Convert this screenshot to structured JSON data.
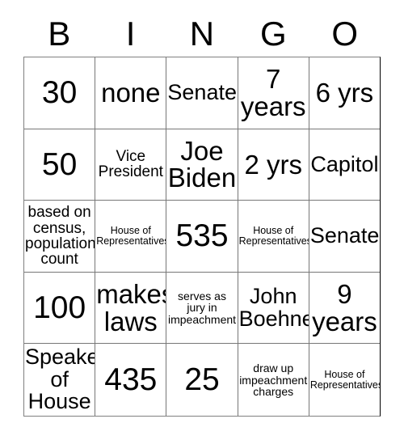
{
  "card": {
    "title_letters": [
      "B",
      "I",
      "N",
      "G",
      "O"
    ],
    "columns": 5,
    "rows": 5,
    "grid_color": "#777777",
    "text_color": "#000000",
    "background_color": "#ffffff",
    "cells": [
      [
        {
          "text": "30",
          "size": "xl"
        },
        {
          "text": "none",
          "size": "lg"
        },
        {
          "text": "Senate",
          "size": "md"
        },
        {
          "text": "7 years",
          "size": "lg"
        },
        {
          "text": "6 yrs",
          "size": "lg"
        }
      ],
      [
        {
          "text": "50",
          "size": "xl"
        },
        {
          "text": "Vice President",
          "size": "sm"
        },
        {
          "text": "Joe Biden",
          "size": "lg"
        },
        {
          "text": "2 yrs",
          "size": "lg"
        },
        {
          "text": "Capitol",
          "size": "md"
        }
      ],
      [
        {
          "text": "based on census, population count",
          "size": "sm"
        },
        {
          "text": "House of Representatives",
          "size": "xxs"
        },
        {
          "text": "535",
          "size": "xl"
        },
        {
          "text": "House of Representatives",
          "size": "xxs"
        },
        {
          "text": "Senate",
          "size": "md"
        }
      ],
      [
        {
          "text": "100",
          "size": "xl"
        },
        {
          "text": "makes laws",
          "size": "lg"
        },
        {
          "text": "serves as jury in impeachment",
          "size": "xs"
        },
        {
          "text": "John Boehner",
          "size": "md"
        },
        {
          "text": "9 years",
          "size": "lg"
        }
      ],
      [
        {
          "text": "Speaker of House",
          "size": "md"
        },
        {
          "text": "435",
          "size": "xl"
        },
        {
          "text": "25",
          "size": "xl"
        },
        {
          "text": "draw up impeachment charges",
          "size": "xs"
        },
        {
          "text": "House of Representatives",
          "size": "xxs"
        }
      ]
    ]
  }
}
